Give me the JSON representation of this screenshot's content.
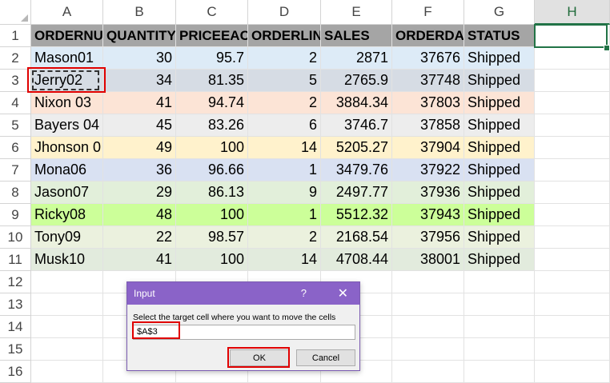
{
  "columns": [
    "A",
    "B",
    "C",
    "D",
    "E",
    "F",
    "G",
    "H"
  ],
  "rows": [
    "1",
    "2",
    "3",
    "4",
    "5",
    "6",
    "7",
    "8",
    "9",
    "10",
    "11",
    "12",
    "13",
    "14",
    "15",
    "16"
  ],
  "headers": [
    "ORDERNUMBER",
    "QUANTITYORDERED",
    "PRICEEACH",
    "ORDERLINENUMBER",
    "SALES",
    "ORDERDATE",
    "STATUS"
  ],
  "headers_shown": [
    "ORDERNU",
    "QUANTITY",
    "PRICEEAC",
    "ORDERLIN",
    "SALES",
    "ORDERDA",
    "STATUS"
  ],
  "data": [
    {
      "name": "Mason01",
      "qty": "30",
      "price": "95.7",
      "line": "2",
      "sales": "2871",
      "date": "37676",
      "status": "Shipped",
      "color": "#ddebf7"
    },
    {
      "name": "Jerry02",
      "qty": "34",
      "price": "81.35",
      "line": "5",
      "sales": "2765.9",
      "date": "37748",
      "status": "Shipped",
      "color": "#d6dce4"
    },
    {
      "name": "Nixon 03",
      "qty": "41",
      "price": "94.74",
      "line": "2",
      "sales": "3884.34",
      "date": "37803",
      "status": "Shipped",
      "color": "#fce4d6"
    },
    {
      "name": "Bayers 04",
      "qty": "45",
      "price": "83.26",
      "line": "6",
      "sales": "3746.7",
      "date": "37858",
      "status": "Shipped",
      "color": "#ededed"
    },
    {
      "name": "Jhonson 0",
      "qty": "49",
      "price": "100",
      "line": "14",
      "sales": "5205.27",
      "date": "37904",
      "status": "Shipped",
      "color": "#fff2cc"
    },
    {
      "name": "Mona06",
      "qty": "36",
      "price": "96.66",
      "line": "1",
      "sales": "3479.76",
      "date": "37922",
      "status": "Shipped",
      "color": "#d9e1f2"
    },
    {
      "name": "Jason07",
      "qty": "29",
      "price": "86.13",
      "line": "9",
      "sales": "2497.77",
      "date": "37936",
      "status": "Shipped",
      "color": "#e2efda"
    },
    {
      "name": "Ricky08",
      "qty": "48",
      "price": "100",
      "line": "1",
      "sales": "5512.32",
      "date": "37943",
      "status": "Shipped",
      "color": "#ccff99"
    },
    {
      "name": "Tony09",
      "qty": "22",
      "price": "98.57",
      "line": "2",
      "sales": "2168.54",
      "date": "37956",
      "status": "Shipped",
      "color": "#ebf1de"
    },
    {
      "name": "Musk10",
      "qty": "41",
      "price": "100",
      "line": "14",
      "sales": "4708.44",
      "date": "38001",
      "status": "Shipped",
      "color": "#e2ebdd"
    }
  ],
  "colors": {
    "header_fill": "#a5a5a5",
    "excel_green": "#217346",
    "dialog_title": "#8a63c8",
    "highlight_red": "#e00000"
  },
  "dialog": {
    "title": "Input",
    "help": "?",
    "close": "✕",
    "prompt": "Select the target cell where you want to move the cells",
    "value": "$A$3",
    "ok": "OK",
    "cancel": "Cancel"
  }
}
